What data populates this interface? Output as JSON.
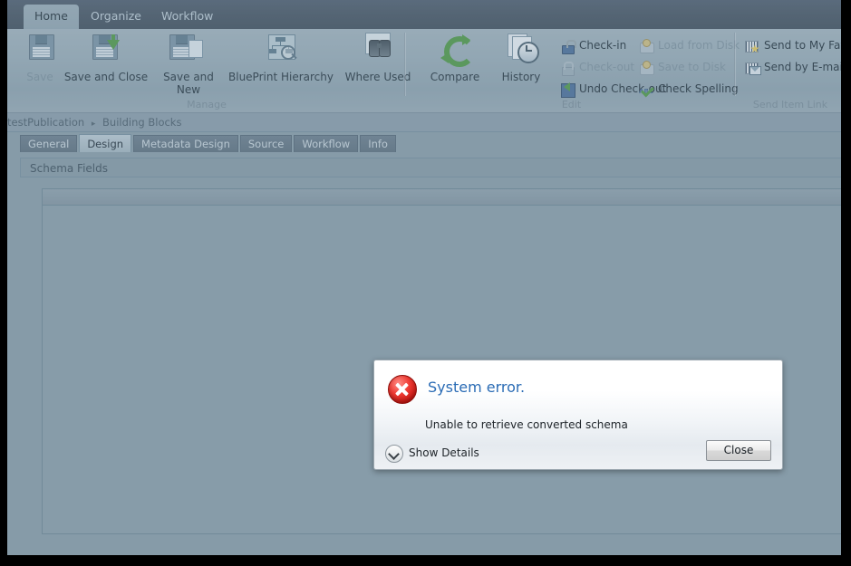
{
  "ribbon": {
    "tabs": [
      {
        "label": "Home",
        "active": true
      },
      {
        "label": "Organize",
        "active": false
      },
      {
        "label": "Workflow",
        "active": false
      }
    ],
    "groups": {
      "manage": {
        "label": "Manage",
        "buttons": [
          {
            "label": "Save",
            "icon": "floppy-disk-icon",
            "disabled": true
          },
          {
            "label": "Save and Close",
            "icon": "floppy-disk-down-arrow-icon",
            "disabled": false
          },
          {
            "label": "Save and New",
            "icon": "floppy-disk-page-icon",
            "disabled": false
          },
          {
            "label": "BluePrint Hierarchy",
            "icon": "blueprint-hierarchy-icon",
            "disabled": false
          },
          {
            "label": "Where Used",
            "icon": "binoculars-icon",
            "disabled": false
          }
        ]
      },
      "edit": {
        "label": "Edit",
        "big_buttons": [
          {
            "label": "Compare",
            "icon": "compare-recycle-icon",
            "disabled": false
          },
          {
            "label": "History",
            "icon": "history-clock-icon",
            "disabled": false
          }
        ],
        "small_buttons": [
          {
            "label": "Check-in",
            "icon": "lock-open-icon",
            "disabled": false
          },
          {
            "label": "Check-out",
            "icon": "lock-closed-icon",
            "disabled": true
          },
          {
            "label": "Undo Check-out",
            "icon": "undo-checkout-icon",
            "disabled": false
          },
          {
            "label": "Load from Disk",
            "icon": "load-from-disk-icon",
            "disabled": true
          },
          {
            "label": "Save to Disk",
            "icon": "save-to-disk-icon",
            "disabled": true
          },
          {
            "label": "Check Spelling",
            "icon": "spell-check-icon",
            "disabled": false
          }
        ]
      },
      "send": {
        "label": "Send Item Link",
        "small_buttons": [
          {
            "label": "Send to My Favorites",
            "icon": "send-favorites-icon",
            "disabled": false
          },
          {
            "label": "Send by E-mail",
            "icon": "send-email-icon",
            "disabled": false
          }
        ]
      }
    }
  },
  "breadcrumb": {
    "root": "testPublication",
    "separator": "▸",
    "current": "Building Blocks"
  },
  "page_tabs": [
    {
      "label": "General",
      "active": false
    },
    {
      "label": "Design",
      "active": true
    },
    {
      "label": "Metadata Design",
      "active": false
    },
    {
      "label": "Source",
      "active": false
    },
    {
      "label": "Workflow",
      "active": false
    },
    {
      "label": "Info",
      "active": false
    }
  ],
  "content": {
    "section_header": "Schema Fields"
  },
  "dialog": {
    "icon": "error-x-icon",
    "title": "System error.",
    "message": "Unable to retrieve converted schema",
    "details_toggle": {
      "label": "Show Details",
      "icon": "chevron-down-icon"
    },
    "close_button": "Close"
  },
  "colors": {
    "app_background": "#8d9fa9",
    "ribbon_background": "#9dafb9",
    "tabbar_background": "#46525f",
    "dialog_title": "#2b6cb5",
    "error_red": "#ee3a33",
    "accent_green": "#4f9b3f"
  }
}
